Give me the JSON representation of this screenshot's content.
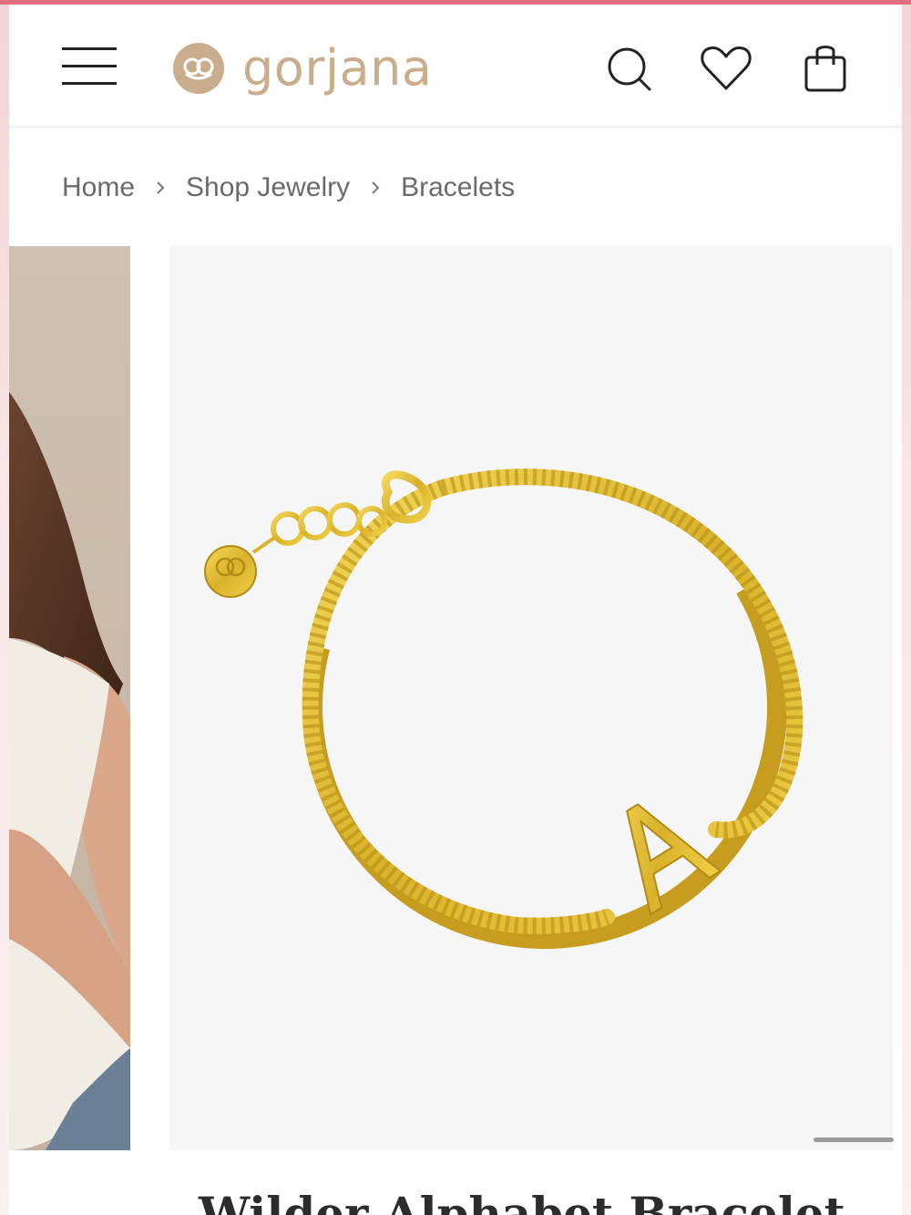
{
  "brand": {
    "name": "gorjana",
    "logo_color": "#c9ad8c"
  },
  "colors": {
    "accent": "#e0707e",
    "gold": "#e3c13a"
  },
  "header": {
    "menu_icon": "hamburger-menu-icon",
    "icons": [
      "search-icon",
      "heart-icon",
      "shopping-bag-icon"
    ]
  },
  "breadcrumb": {
    "items": [
      "Home",
      "Shop Jewelry",
      "Bracelets"
    ]
  },
  "product": {
    "title": "Wilder Alphabet Bracelet",
    "initial": "A"
  }
}
